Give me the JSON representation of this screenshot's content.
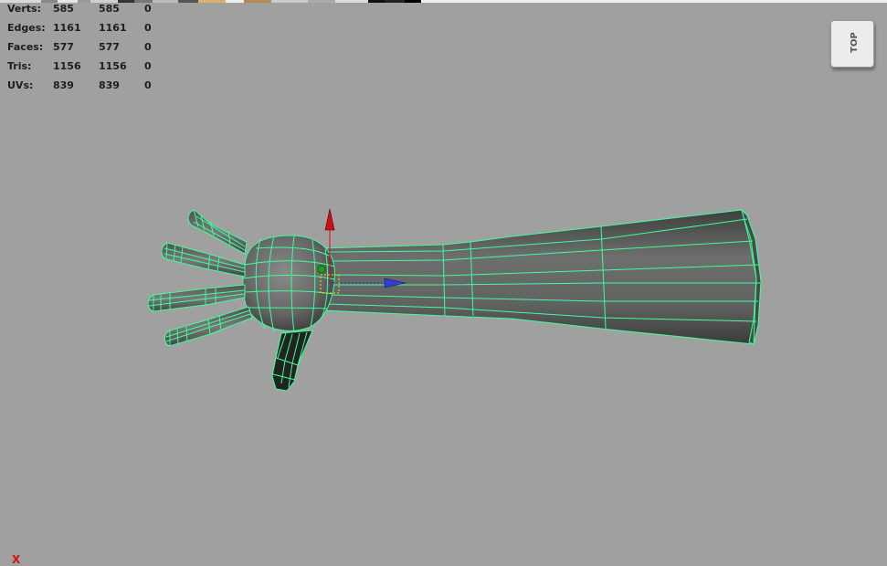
{
  "hud": {
    "rows": [
      {
        "label": "Verts:",
        "v1": "585",
        "v2": "585",
        "v3": "0"
      },
      {
        "label": "Edges:",
        "v1": "1161",
        "v2": "1161",
        "v3": "0"
      },
      {
        "label": "Faces:",
        "v1": "577",
        "v2": "577",
        "v3": "0"
      },
      {
        "label": "Tris:",
        "v1": "1156",
        "v2": "1156",
        "v3": "0"
      },
      {
        "label": "UVs:",
        "v1": "839",
        "v2": "839",
        "v3": "0"
      }
    ]
  },
  "viewcube": {
    "label": "TOP"
  },
  "axis_indicator": {
    "x_label": "X"
  },
  "colors": {
    "viewport_background": "#a0a0a0",
    "wireframe": "#3dff9a",
    "mesh_fill": "#6a6a6a",
    "manipulator_y_axis": "#cc1010",
    "manipulator_x_axis": "#2030c0",
    "pivot_center": "#1aa01a",
    "pivot_box": "#f0e000",
    "axis_x_label": "#dd1111"
  },
  "icons": {
    "viewcube": "viewcube-top-icon",
    "manipulator": "move-manipulator-icon"
  }
}
